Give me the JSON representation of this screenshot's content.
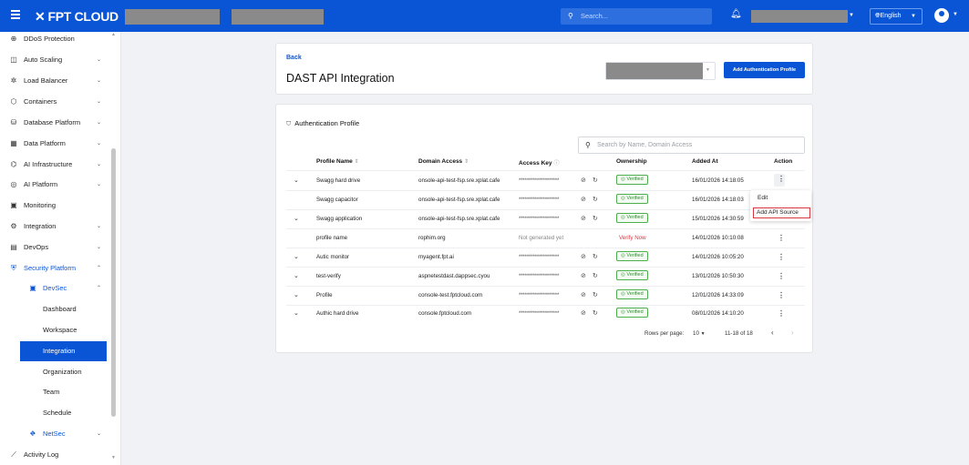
{
  "topbar": {
    "brand": "FPT CLOUD",
    "search_placeholder": "Search...",
    "language": "English"
  },
  "sidebar": {
    "items": [
      {
        "label": "DDoS Protection",
        "icon": "shield-icon"
      },
      {
        "label": "Auto Scaling",
        "icon": "scaling-icon"
      },
      {
        "label": "Load Balancer",
        "icon": "balancer-icon"
      },
      {
        "label": "Containers",
        "icon": "container-icon"
      },
      {
        "label": "Database Platform",
        "icon": "database-icon"
      },
      {
        "label": "Data Platform",
        "icon": "data-icon"
      },
      {
        "label": "AI Infrastructure",
        "icon": "ai-infra-icon"
      },
      {
        "label": "AI Platform",
        "icon": "ai-platform-icon"
      },
      {
        "label": "Monitoring",
        "icon": "monitor-icon"
      },
      {
        "label": "Integration",
        "icon": "integration-icon"
      },
      {
        "label": "DevOps",
        "icon": "devops-icon"
      },
      {
        "label": "Security Platform",
        "icon": "security-icon"
      }
    ],
    "devsec": "DevSec",
    "sub_items": [
      "Dashboard",
      "Workspace",
      "Integration",
      "Organization",
      "Team",
      "Schedule"
    ],
    "netsec": "NetSec",
    "activity_log": "Activity Log"
  },
  "header_card": {
    "back": "Back",
    "title": "DAST API Integration",
    "add_button": "Add Authentication Profile"
  },
  "profiles": {
    "section_title": "Authentication Profile",
    "search_placeholder": "Search by Name, Domain Access",
    "columns": [
      "Profile Name",
      "Domain Access",
      "Access Key",
      "Ownership",
      "Added At",
      "Action"
    ],
    "rows": [
      {
        "name": "Swagg hard drive",
        "domain": "onsole-api-test-fsp.sre.xplat.cafe",
        "key": "********************",
        "ownership": "Verified",
        "added": "16/01/2026 14:18:05",
        "expandable": true
      },
      {
        "name": "Swagg capacitor",
        "domain": "onsole-api-test-fsp.sre.xplat.cafe",
        "key": "********************",
        "ownership": "Verified",
        "added": "16/01/2026 14:18:03",
        "expandable": false
      },
      {
        "name": "Swagg application",
        "domain": "onsole-api-test-fsp.sre.xplat.cafe",
        "key": "********************",
        "ownership": "Verified",
        "added": "15/01/2026 14:30:59",
        "expandable": true
      },
      {
        "name": "profile name",
        "domain": "rophim.org",
        "key": "Not generated yet",
        "ownership": "Verify Now",
        "added": "14/01/2026 10:10:08",
        "expandable": false
      },
      {
        "name": "Autic monitor",
        "domain": "myagent.fpt.ai",
        "key": "********************",
        "ownership": "Verified",
        "added": "14/01/2026 10:05:20",
        "expandable": true
      },
      {
        "name": "test-verify",
        "domain": "aspnetestdast.dappsec.cyou",
        "key": "********************",
        "ownership": "Verified",
        "added": "13/01/2026 10:50:30",
        "expandable": true
      },
      {
        "name": "Profile",
        "domain": "console-test.fptcloud.com",
        "key": "********************",
        "ownership": "Verified",
        "added": "12/01/2026 14:33:09",
        "expandable": true
      },
      {
        "name": "Authic hard drive",
        "domain": "console.fptcloud.com",
        "key": "********************",
        "ownership": "Verified",
        "added": "08/01/2026 14:10:20",
        "expandable": true
      }
    ],
    "menu": {
      "edit": "Edit",
      "add_api_source": "Add API Source"
    },
    "pagination": {
      "rows_per_page_label": "Rows per page:",
      "rows_per_page": "10",
      "range": "11-18 of 18"
    }
  }
}
